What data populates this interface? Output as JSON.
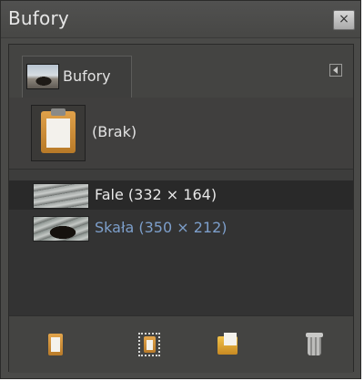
{
  "window": {
    "title": "Bufory",
    "close_glyph": "×"
  },
  "tab": {
    "label": "Bufory",
    "menu_icon": "tab-menu-icon"
  },
  "none_item": {
    "label": "(Brak)",
    "icon": "clipboard-icon"
  },
  "buffers": [
    {
      "label": "Fale (332 × 164)",
      "thumbnail": "waves-thumbnail",
      "selected": true
    },
    {
      "label": "Skała (350 × 212)",
      "thumbnail": "rock-thumbnail",
      "selected": false
    }
  ],
  "toolbar": {
    "buttons": [
      {
        "icon": "paste-buffer-icon"
      },
      {
        "icon": "paste-into-icon"
      },
      {
        "icon": "paste-as-new-icon"
      },
      {
        "icon": "delete-buffer-icon"
      }
    ]
  },
  "colors": {
    "window_bg": "#4a4a48",
    "list_bg": "#333333",
    "selected_row": "#292929",
    "link_text": "#7d9fcb"
  }
}
